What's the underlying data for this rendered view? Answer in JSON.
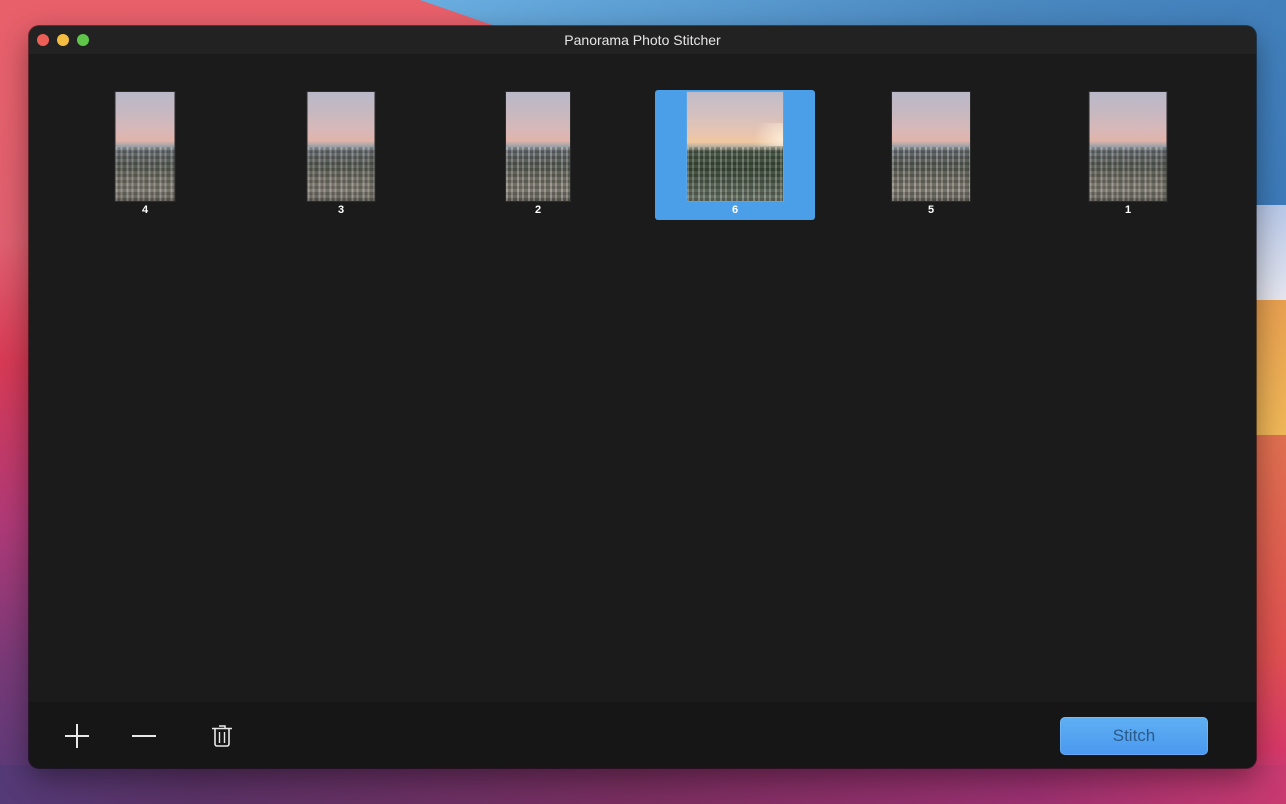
{
  "window": {
    "title": "Panorama Photo Stitcher",
    "traffic_lights": [
      {
        "name": "close",
        "color": "#ec5f57"
      },
      {
        "name": "minimize",
        "color": "#f4bd41"
      },
      {
        "name": "zoom",
        "color": "#5fc64a"
      }
    ]
  },
  "thumbnails": [
    {
      "label": "4",
      "selected": false
    },
    {
      "label": "3",
      "selected": false
    },
    {
      "label": "2",
      "selected": false
    },
    {
      "label": "6",
      "selected": true
    },
    {
      "label": "5",
      "selected": false
    },
    {
      "label": "1",
      "selected": false
    }
  ],
  "toolbar": {
    "add_icon": "plus-icon",
    "remove_icon": "minus-icon",
    "delete_icon": "trash-icon",
    "stitch_label": "Stitch"
  },
  "colors": {
    "selection": "#4a9fe8",
    "stitch_button": "#4a98f0",
    "window_bg": "#1b1b1b"
  }
}
